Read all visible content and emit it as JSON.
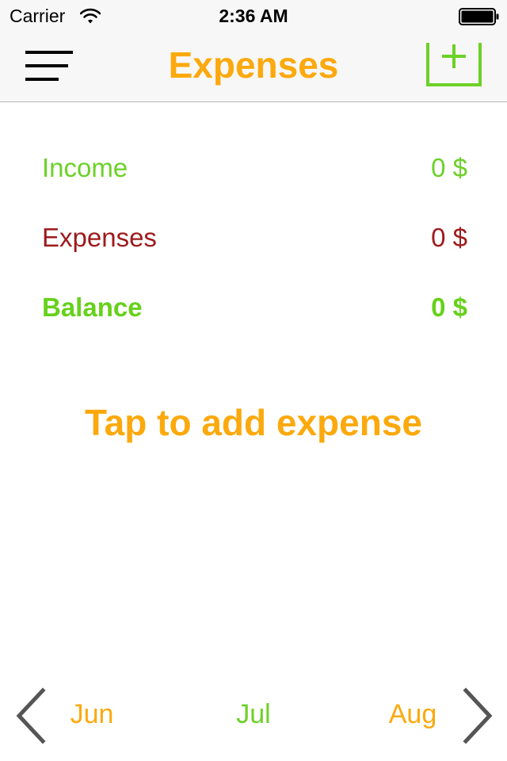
{
  "status_bar": {
    "carrier": "Carrier",
    "time": "2:36 AM",
    "wifi_icon": "wifi-icon",
    "battery_icon": "battery-icon",
    "battery_level": 1.0
  },
  "nav_bar": {
    "title": "Expenses",
    "menu_icon": "hamburger-menu-icon",
    "add_icon": "add-box-icon"
  },
  "summary": {
    "income_label": "Income",
    "income_value": "0 $",
    "expenses_label": "Expenses",
    "expenses_value": "0 $",
    "balance_label": "Balance",
    "balance_value": "0 $"
  },
  "prompt": {
    "text": "Tap to add expense"
  },
  "month_nav": {
    "prev_label": "Jun",
    "current_label": "Jul",
    "next_label": "Aug",
    "prev_icon": "chevron-left-icon",
    "next_icon": "chevron-right-icon"
  },
  "colors": {
    "accent_orange": "#fca90d",
    "income_green": "#6cd127",
    "expense_red": "#9e1a1c",
    "bar_background": "#f7f7f7"
  }
}
